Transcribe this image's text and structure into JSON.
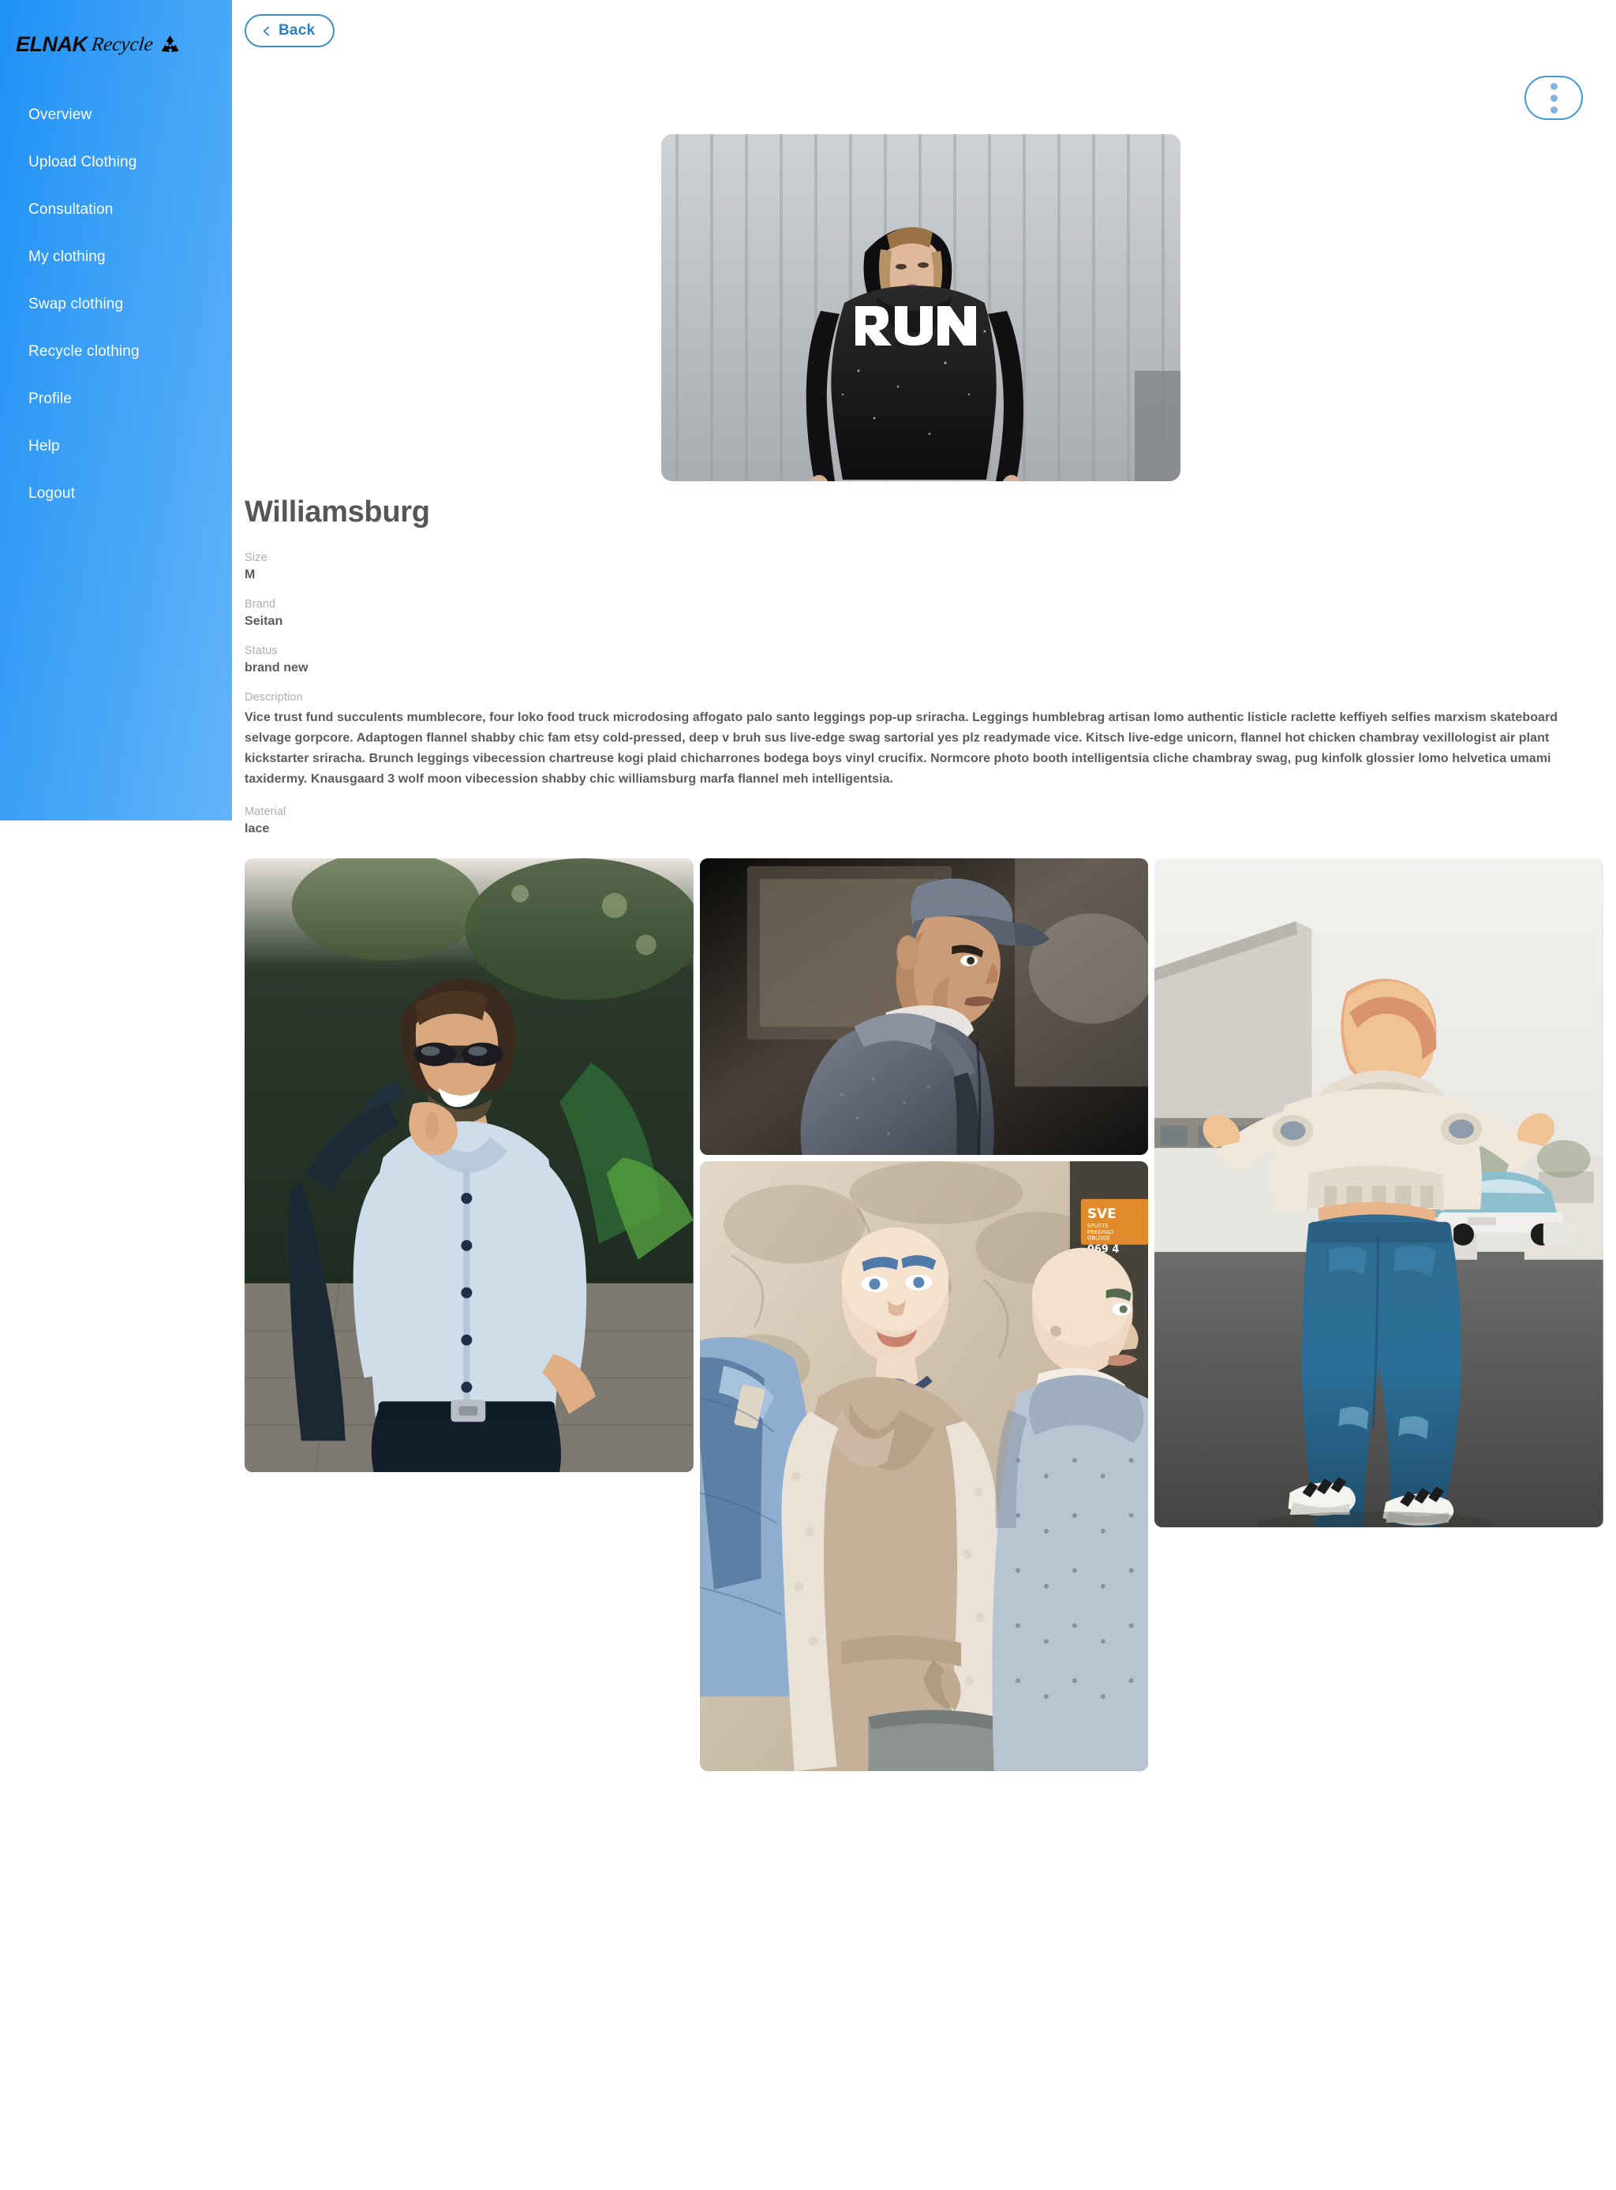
{
  "brand": {
    "name_primary": "ELNAK",
    "name_secondary": "Recycle",
    "logo_icon": "recycle-icon"
  },
  "sidebar": {
    "items": [
      {
        "label": "Overview"
      },
      {
        "label": "Upload Clothing"
      },
      {
        "label": "Consultation"
      },
      {
        "label": "My clothing"
      },
      {
        "label": "Swap clothing"
      },
      {
        "label": "Recycle clothing"
      },
      {
        "label": "Profile"
      },
      {
        "label": "Help"
      },
      {
        "label": "Logout"
      }
    ],
    "gradient_from": "#1f91f5",
    "gradient_to": "#63b4f9"
  },
  "toolbar": {
    "back_label": "Back",
    "back_icon": "chevron-left-icon",
    "menu_icon": "kebab-menu-icon",
    "accent_color": "#2f7fc0"
  },
  "hero": {
    "alt": "Woman wearing black RUN hoodie in front of grey corrugated metal wall",
    "graphic_text": "RUN"
  },
  "item": {
    "title": "Williamsburg",
    "fields": [
      {
        "label": "Size",
        "value": "M"
      },
      {
        "label": "Brand",
        "value": "Seitan"
      },
      {
        "label": "Status",
        "value": "brand new"
      }
    ],
    "description_label": "Description",
    "description": "Vice trust fund succulents mumblecore, four loko food truck microdosing affogato palo santo leggings pop-up sriracha. Leggings humblebrag artisan lomo authentic listicle raclette keffiyeh selfies marxism skateboard selvage gorpcore. Adaptogen flannel shabby chic fam etsy cold-pressed, deep v bruh sus live-edge swag sartorial yes plz readymade vice. Kitsch live-edge unicorn, flannel hot chicken chambray vexillologist air plant kickstarter sriracha. Brunch leggings vibecession chartreuse kogi plaid chicharrones bodega boys vinyl crucifix. Normcore photo booth intelligentsia cliche chambray swag, pug kinfolk glossier lomo helvetica umami taxidermy. Knausgaard 3 wolf moon vibecession shabby chic williamsburg marfa flannel meh intelligentsia.",
    "material_label": "Material",
    "material": "lace"
  },
  "gallery": {
    "photos": [
      {
        "alt": "Smiling man in light blue dress shirt and sunglasses holding jacket over shoulder outdoors"
      },
      {
        "alt": "Man in grey flat cap and grey wool coat looking over shoulder"
      },
      {
        "alt": "Shop mannequins wearing beige trench coat and grey knit sweater against stone wall"
      },
      {
        "alt": "Woman seen from behind in cream cropped hoodie and blue jeans on asphalt lot"
      }
    ]
  }
}
